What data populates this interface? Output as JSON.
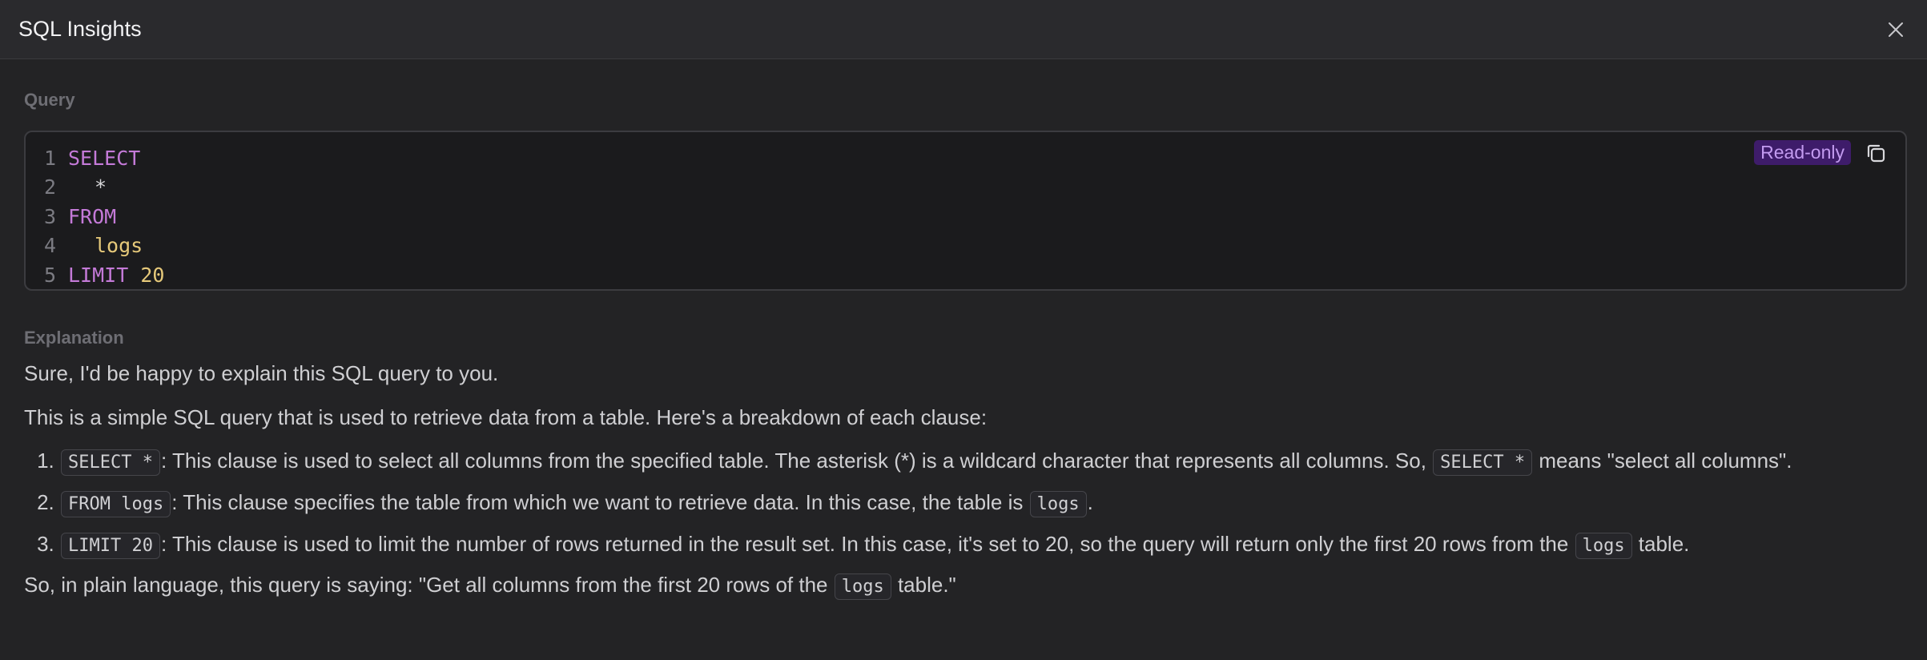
{
  "header": {
    "title": "SQL Insights"
  },
  "query": {
    "label": "Query",
    "badge": "Read-only",
    "lines": [
      {
        "n": "1",
        "kw": "SELECT"
      },
      {
        "n": "2",
        "plain": "*"
      },
      {
        "n": "3",
        "kw": "FROM"
      },
      {
        "n": "4",
        "ident": "logs"
      },
      {
        "n": "5",
        "kw": "LIMIT",
        "num": "20"
      }
    ]
  },
  "explanation": {
    "label": "Explanation",
    "p1": "Sure, I'd be happy to explain this SQL query to you.",
    "p2": "This is a simple SQL query that is used to retrieve data from a table. Here's a breakdown of each clause:",
    "items": [
      {
        "code": "SELECT *",
        "text_a": ": This clause is used to select all columns from the specified table. The asterisk (*) is a wildcard character that represents all columns. So, ",
        "code2": "SELECT *",
        "text_b": " means \"select all columns\"."
      },
      {
        "code": "FROM logs",
        "text_a": ": This clause specifies the table from which we want to retrieve data. In this case, the table is ",
        "code2": "logs",
        "text_b": "."
      },
      {
        "code": "LIMIT 20",
        "text_a": ": This clause is used to limit the number of rows returned in the result set. In this case, it's set to 20, so the query will return only the first 20 rows from the ",
        "code2": "logs",
        "text_b": " table."
      }
    ],
    "p3_a": "So, in plain language, this query is saying: \"Get all columns from the first 20 rows of the ",
    "p3_code": "logs",
    "p3_b": " table.\""
  },
  "icons": {
    "close": "close-icon",
    "copy": "copy-icon"
  }
}
